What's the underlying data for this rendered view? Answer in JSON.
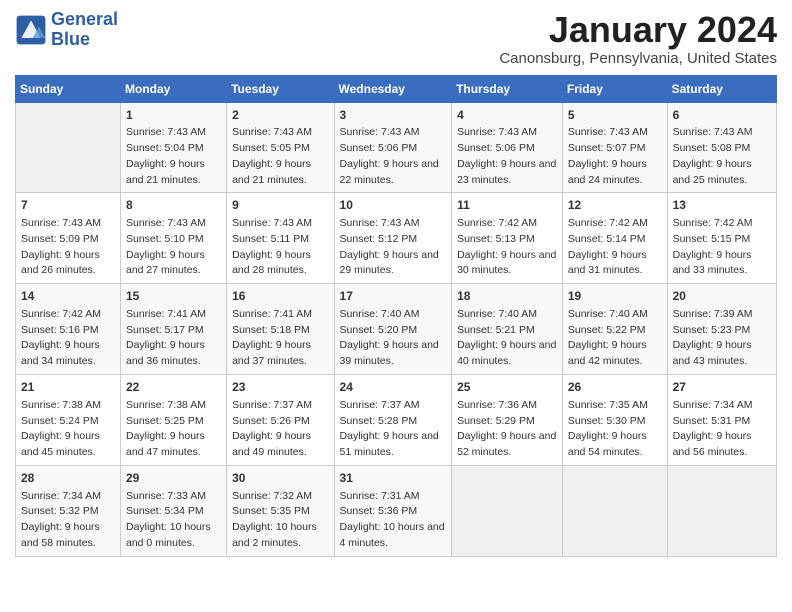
{
  "header": {
    "logo_line1": "General",
    "logo_line2": "Blue",
    "month_year": "January 2024",
    "location": "Canonsburg, Pennsylvania, United States"
  },
  "weekdays": [
    "Sunday",
    "Monday",
    "Tuesday",
    "Wednesday",
    "Thursday",
    "Friday",
    "Saturday"
  ],
  "weeks": [
    [
      {
        "num": "",
        "sunrise": "",
        "sunset": "",
        "daylight": ""
      },
      {
        "num": "1",
        "sunrise": "Sunrise: 7:43 AM",
        "sunset": "Sunset: 5:04 PM",
        "daylight": "Daylight: 9 hours and 21 minutes."
      },
      {
        "num": "2",
        "sunrise": "Sunrise: 7:43 AM",
        "sunset": "Sunset: 5:05 PM",
        "daylight": "Daylight: 9 hours and 21 minutes."
      },
      {
        "num": "3",
        "sunrise": "Sunrise: 7:43 AM",
        "sunset": "Sunset: 5:06 PM",
        "daylight": "Daylight: 9 hours and 22 minutes."
      },
      {
        "num": "4",
        "sunrise": "Sunrise: 7:43 AM",
        "sunset": "Sunset: 5:06 PM",
        "daylight": "Daylight: 9 hours and 23 minutes."
      },
      {
        "num": "5",
        "sunrise": "Sunrise: 7:43 AM",
        "sunset": "Sunset: 5:07 PM",
        "daylight": "Daylight: 9 hours and 24 minutes."
      },
      {
        "num": "6",
        "sunrise": "Sunrise: 7:43 AM",
        "sunset": "Sunset: 5:08 PM",
        "daylight": "Daylight: 9 hours and 25 minutes."
      }
    ],
    [
      {
        "num": "7",
        "sunrise": "Sunrise: 7:43 AM",
        "sunset": "Sunset: 5:09 PM",
        "daylight": "Daylight: 9 hours and 26 minutes."
      },
      {
        "num": "8",
        "sunrise": "Sunrise: 7:43 AM",
        "sunset": "Sunset: 5:10 PM",
        "daylight": "Daylight: 9 hours and 27 minutes."
      },
      {
        "num": "9",
        "sunrise": "Sunrise: 7:43 AM",
        "sunset": "Sunset: 5:11 PM",
        "daylight": "Daylight: 9 hours and 28 minutes."
      },
      {
        "num": "10",
        "sunrise": "Sunrise: 7:43 AM",
        "sunset": "Sunset: 5:12 PM",
        "daylight": "Daylight: 9 hours and 29 minutes."
      },
      {
        "num": "11",
        "sunrise": "Sunrise: 7:42 AM",
        "sunset": "Sunset: 5:13 PM",
        "daylight": "Daylight: 9 hours and 30 minutes."
      },
      {
        "num": "12",
        "sunrise": "Sunrise: 7:42 AM",
        "sunset": "Sunset: 5:14 PM",
        "daylight": "Daylight: 9 hours and 31 minutes."
      },
      {
        "num": "13",
        "sunrise": "Sunrise: 7:42 AM",
        "sunset": "Sunset: 5:15 PM",
        "daylight": "Daylight: 9 hours and 33 minutes."
      }
    ],
    [
      {
        "num": "14",
        "sunrise": "Sunrise: 7:42 AM",
        "sunset": "Sunset: 5:16 PM",
        "daylight": "Daylight: 9 hours and 34 minutes."
      },
      {
        "num": "15",
        "sunrise": "Sunrise: 7:41 AM",
        "sunset": "Sunset: 5:17 PM",
        "daylight": "Daylight: 9 hours and 36 minutes."
      },
      {
        "num": "16",
        "sunrise": "Sunrise: 7:41 AM",
        "sunset": "Sunset: 5:18 PM",
        "daylight": "Daylight: 9 hours and 37 minutes."
      },
      {
        "num": "17",
        "sunrise": "Sunrise: 7:40 AM",
        "sunset": "Sunset: 5:20 PM",
        "daylight": "Daylight: 9 hours and 39 minutes."
      },
      {
        "num": "18",
        "sunrise": "Sunrise: 7:40 AM",
        "sunset": "Sunset: 5:21 PM",
        "daylight": "Daylight: 9 hours and 40 minutes."
      },
      {
        "num": "19",
        "sunrise": "Sunrise: 7:40 AM",
        "sunset": "Sunset: 5:22 PM",
        "daylight": "Daylight: 9 hours and 42 minutes."
      },
      {
        "num": "20",
        "sunrise": "Sunrise: 7:39 AM",
        "sunset": "Sunset: 5:23 PM",
        "daylight": "Daylight: 9 hours and 43 minutes."
      }
    ],
    [
      {
        "num": "21",
        "sunrise": "Sunrise: 7:38 AM",
        "sunset": "Sunset: 5:24 PM",
        "daylight": "Daylight: 9 hours and 45 minutes."
      },
      {
        "num": "22",
        "sunrise": "Sunrise: 7:38 AM",
        "sunset": "Sunset: 5:25 PM",
        "daylight": "Daylight: 9 hours and 47 minutes."
      },
      {
        "num": "23",
        "sunrise": "Sunrise: 7:37 AM",
        "sunset": "Sunset: 5:26 PM",
        "daylight": "Daylight: 9 hours and 49 minutes."
      },
      {
        "num": "24",
        "sunrise": "Sunrise: 7:37 AM",
        "sunset": "Sunset: 5:28 PM",
        "daylight": "Daylight: 9 hours and 51 minutes."
      },
      {
        "num": "25",
        "sunrise": "Sunrise: 7:36 AM",
        "sunset": "Sunset: 5:29 PM",
        "daylight": "Daylight: 9 hours and 52 minutes."
      },
      {
        "num": "26",
        "sunrise": "Sunrise: 7:35 AM",
        "sunset": "Sunset: 5:30 PM",
        "daylight": "Daylight: 9 hours and 54 minutes."
      },
      {
        "num": "27",
        "sunrise": "Sunrise: 7:34 AM",
        "sunset": "Sunset: 5:31 PM",
        "daylight": "Daylight: 9 hours and 56 minutes."
      }
    ],
    [
      {
        "num": "28",
        "sunrise": "Sunrise: 7:34 AM",
        "sunset": "Sunset: 5:32 PM",
        "daylight": "Daylight: 9 hours and 58 minutes."
      },
      {
        "num": "29",
        "sunrise": "Sunrise: 7:33 AM",
        "sunset": "Sunset: 5:34 PM",
        "daylight": "Daylight: 10 hours and 0 minutes."
      },
      {
        "num": "30",
        "sunrise": "Sunrise: 7:32 AM",
        "sunset": "Sunset: 5:35 PM",
        "daylight": "Daylight: 10 hours and 2 minutes."
      },
      {
        "num": "31",
        "sunrise": "Sunrise: 7:31 AM",
        "sunset": "Sunset: 5:36 PM",
        "daylight": "Daylight: 10 hours and 4 minutes."
      },
      {
        "num": "",
        "sunrise": "",
        "sunset": "",
        "daylight": ""
      },
      {
        "num": "",
        "sunrise": "",
        "sunset": "",
        "daylight": ""
      },
      {
        "num": "",
        "sunrise": "",
        "sunset": "",
        "daylight": ""
      }
    ]
  ]
}
